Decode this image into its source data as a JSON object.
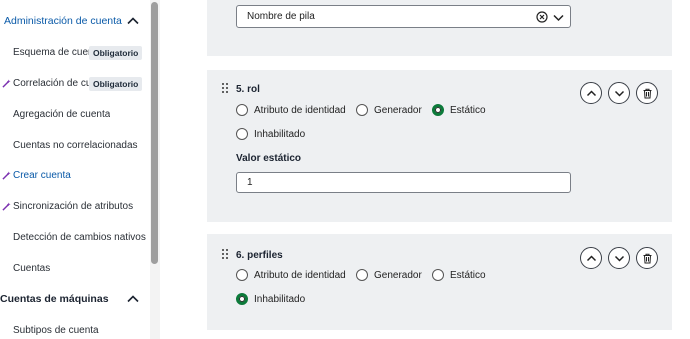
{
  "sidebar": {
    "section_account": "Administración de cuenta",
    "items": [
      {
        "label": "Esquema de cuent",
        "badge": "Obligatorio",
        "icon": "none",
        "active": false
      },
      {
        "label": "Correlación de cue",
        "badge": "Obligatorio",
        "icon": "wand-icon",
        "active": false
      },
      {
        "label": "Agregación de cuenta",
        "icon": "none",
        "active": false
      },
      {
        "label": "Cuentas no correlacionadas",
        "icon": "none",
        "active": false
      },
      {
        "label": "Crear cuenta",
        "icon": "wand-icon",
        "active": true
      },
      {
        "label": "Sincronización de atributos",
        "icon": "wand-icon",
        "active": false
      },
      {
        "label": "Detección de cambios nativos",
        "icon": "none",
        "active": false
      },
      {
        "label": "Cuentas",
        "icon": "none",
        "active": false
      }
    ],
    "section_machines": "Cuentas de máquinas",
    "machine_items": [
      {
        "label": "Subtipos de cuenta"
      }
    ]
  },
  "top_panel": {
    "select_value": "Nombre de pila"
  },
  "rules": [
    {
      "title": "5. rol",
      "options": [
        "Atributo de identidad",
        "Generador",
        "Estático",
        "Inhabilitado"
      ],
      "selected": "Estático",
      "static_label": "Valor estático",
      "static_value": "1"
    },
    {
      "title": "6. perfiles",
      "options": [
        "Atributo de identidad",
        "Generador",
        "Estático",
        "Inhabilitado"
      ],
      "selected": "Inhabilitado"
    }
  ],
  "colors": {
    "accent_blue": "#0a5aa8",
    "radio_selected": "#0c7a3a",
    "panel_bg": "#eef0f2",
    "wand_purple": "#7a2fb0"
  }
}
